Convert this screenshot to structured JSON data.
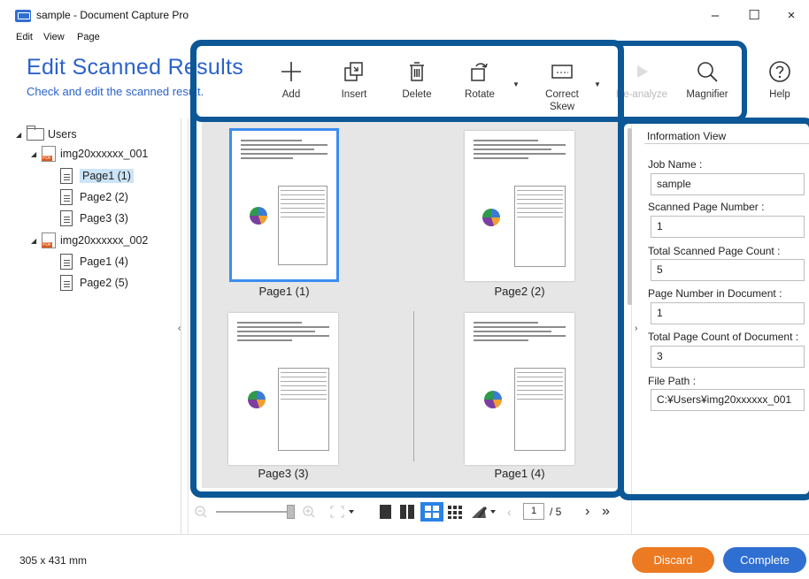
{
  "window": {
    "title": "sample - Document Capture Pro",
    "minimize": "–",
    "maximize": "☐",
    "close": "×"
  },
  "menu": [
    "Edit",
    "View",
    "Page"
  ],
  "header": {
    "title": "Edit Scanned Results",
    "subtitle": "Check and edit the scanned result."
  },
  "toolbar": {
    "add": "Add",
    "insert": "Insert",
    "delete": "Delete",
    "rotate": "Rotate",
    "correct_skew_line1": "Correct",
    "correct_skew_line2": "Skew",
    "reanalyze": "Re-analyze",
    "magnifier": "Magnifier",
    "help": "Help"
  },
  "tree": {
    "root": "Users",
    "docs": [
      {
        "name": "img20xxxxxx_001",
        "pages": [
          "Page1 (1)",
          "Page2 (2)",
          "Page3 (3)"
        ]
      },
      {
        "name": "img20xxxxxx_002",
        "pages": [
          "Page1 (4)",
          "Page2 (5)"
        ]
      }
    ],
    "selected": "Page1 (1)"
  },
  "thumbnails": [
    "Page1 (1)",
    "Page2 (2)",
    "Page3 (3)",
    "Page1 (4)"
  ],
  "pager": {
    "current": "1",
    "total": "/ 5"
  },
  "info": {
    "title": "Information View",
    "job_name_label": "Job Name :",
    "job_name": "sample",
    "scanned_page_number_label": "Scanned Page Number :",
    "scanned_page_number": "1",
    "total_scanned_label": "Total Scanned Page Count :",
    "total_scanned": "5",
    "page_number_in_doc_label": "Page Number in Document :",
    "page_number_in_doc": "1",
    "total_page_count_doc_label": "Total Page Count of Document :",
    "total_page_count_doc": "3",
    "file_path_label": "File Path :",
    "file_path": "C:¥Users¥img20xxxxxx_001"
  },
  "status": {
    "size": "305 x 431 mm",
    "discard": "Discard",
    "complete": "Complete"
  },
  "colors": {
    "accent": "#2b62c9",
    "highlight": "#0c5796",
    "discard": "#ec7a22",
    "complete": "#2f6fd1"
  }
}
